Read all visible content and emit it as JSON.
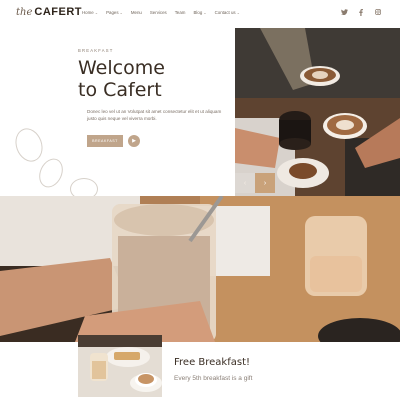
{
  "header": {
    "logo_script": "the",
    "logo_text": "CAFERT",
    "nav": [
      "Home",
      "Pages",
      "Menu",
      "Services",
      "Team",
      "Blog",
      "Contact us"
    ],
    "social_icons": [
      "twitter-icon",
      "facebook-icon",
      "instagram-icon"
    ]
  },
  "hero": {
    "eyebrow": "BREAKFAST",
    "title_line1": "Welcome",
    "title_line2": "to Cafert",
    "description": "Donec leo vel ut an Volutpat sit amet consectetur elit et ut aliquam justo quis neque vel viverra morbi.",
    "button_label": "BREAKFAST",
    "play_icon": "play-icon",
    "prev_icon": "arrow-left-icon",
    "next_icon": "arrow-right-icon"
  },
  "promo": {
    "title": "Free Breakfast!",
    "subtitle": "Every 5th breakfast is a gift"
  },
  "colors": {
    "accent": "#c0a58b",
    "arrow_active": "#c9a27a",
    "text_dark": "#3a2e24"
  }
}
